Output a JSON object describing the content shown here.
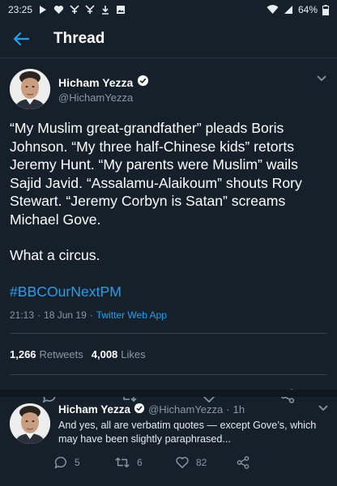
{
  "status_bar": {
    "time": "23:25",
    "battery": "64%",
    "icons_left": [
      "play-icon",
      "heart-icon",
      "mood-icon",
      "mood-icon",
      "download-icon",
      "image-icon"
    ],
    "icons_right": [
      "wifi-icon",
      "signal-icon",
      "battery-icon"
    ]
  },
  "app_bar": {
    "title": "Thread",
    "back_icon": "arrow-left-icon"
  },
  "tweet": {
    "author_name": "Hicham Yezza",
    "author_handle": "@HichamYezza",
    "verified": true,
    "text_p1": "“My Muslim great-grandfather” pleads Boris Johnson. “My three half-Chinese kids” retorts Jeremy Hunt. “My parents were Muslim” wails Sajid Javid. “Assalamu-Alaikoum” shouts Rory Stewart. “Jeremy Corbyn is Satan” screams Michael Gove.",
    "text_p2": "What a circus.",
    "hashtag": "#BBCOurNextPM",
    "time": "21:13",
    "dot1": "·",
    "date": "18 Jun 19",
    "dot2": "·",
    "app": "Twitter Web App",
    "retweets_count": "1,266",
    "retweets_label": "Retweets",
    "likes_count": "4,008",
    "likes_label": "Likes",
    "actions": [
      "reply-icon",
      "retweet-icon",
      "like-icon",
      "share-icon"
    ]
  },
  "reply": {
    "author_name": "Hicham Yezza",
    "author_handle": "@HichamYezza",
    "dot": "·",
    "age": "1h",
    "text": "And yes, all are verbatim quotes — except Gove’s, which may have been slightly paraphrased...",
    "replies": "5",
    "retweets": "6",
    "likes": "82"
  },
  "colors": {
    "background": "#15202b",
    "accent": "#1da1f2",
    "secondary_text": "#8899a6"
  }
}
